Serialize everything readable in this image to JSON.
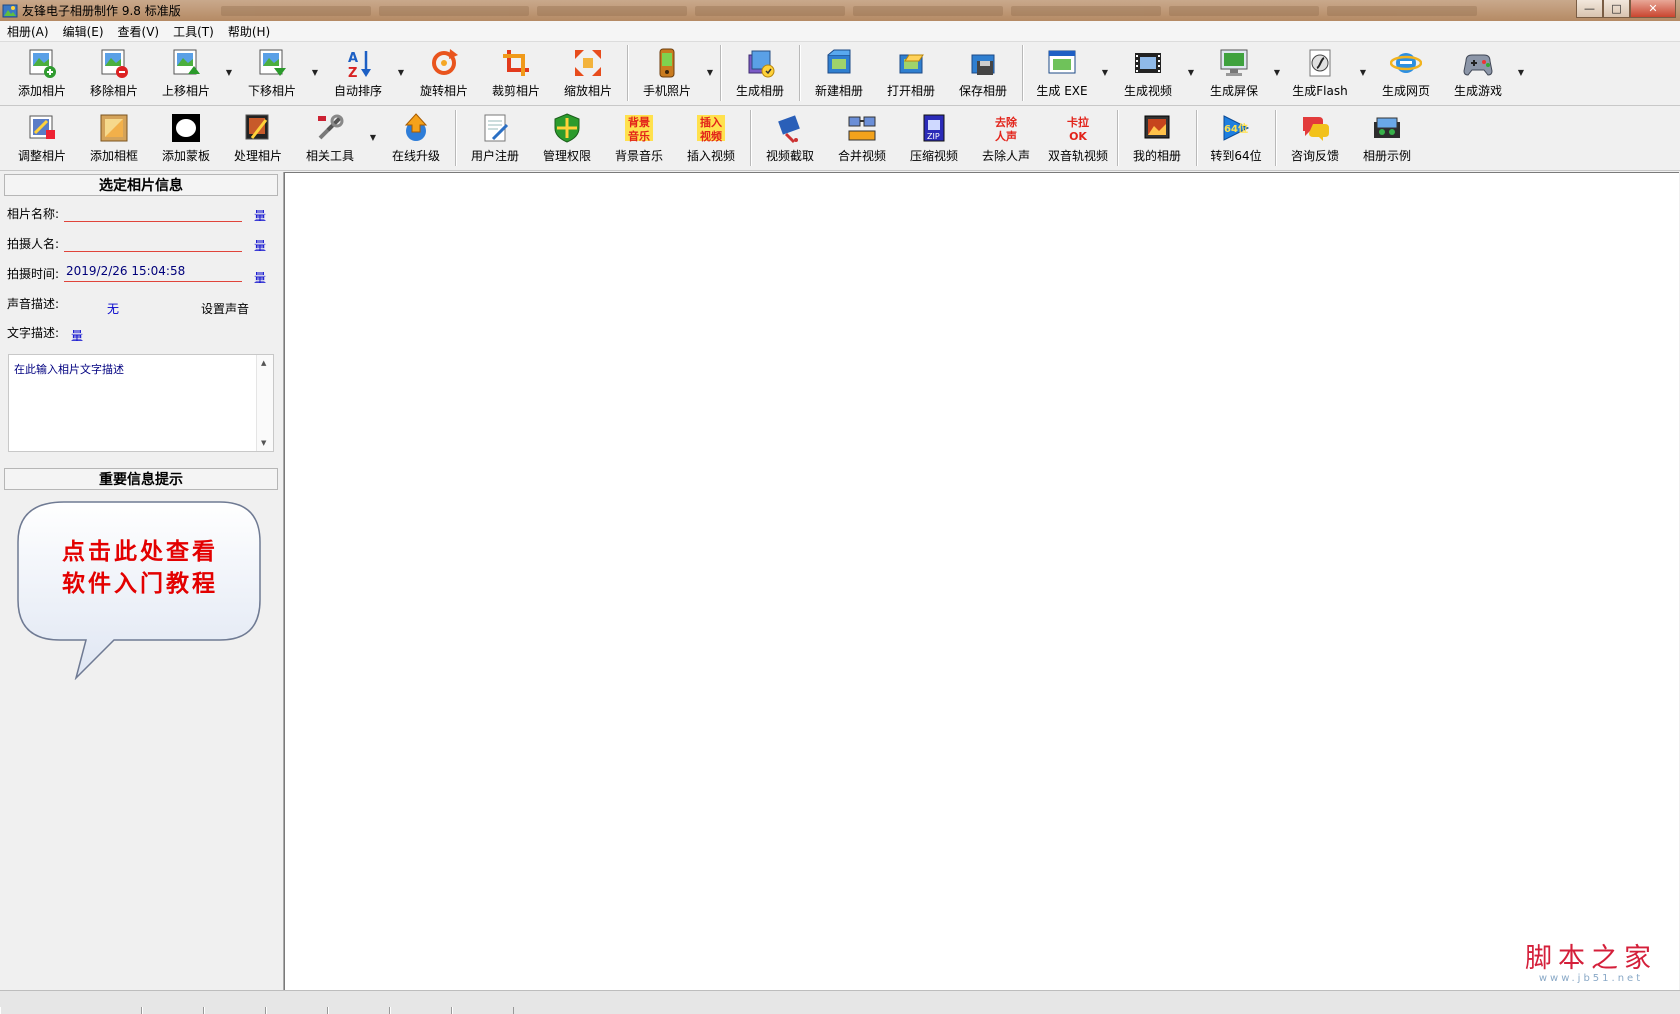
{
  "window": {
    "title": "友锋电子相册制作 9.8 标准版",
    "controls": {
      "minimize": "—",
      "maximize": "□",
      "close": "✕"
    }
  },
  "menu": [
    "相册(A)",
    "编辑(E)",
    "查看(V)",
    "工具(T)",
    "帮助(H)"
  ],
  "toolbar_top": {
    "groups": [
      [
        {
          "label": "添加相片",
          "icon": "add-photo-icon"
        },
        {
          "label": "移除相片",
          "icon": "remove-photo-icon"
        },
        {
          "label": "上移相片",
          "icon": "move-up-icon",
          "dropdown": true
        },
        {
          "label": "下移相片",
          "icon": "move-down-icon",
          "dropdown": true
        },
        {
          "label": "自动排序",
          "icon": "sort-az-icon",
          "dropdown": true
        },
        {
          "label": "旋转相片",
          "icon": "rotate-icon"
        },
        {
          "label": "裁剪相片",
          "icon": "crop-icon"
        },
        {
          "label": "缩放相片",
          "icon": "zoom-icon"
        }
      ],
      [
        {
          "label": "手机照片",
          "icon": "phone-icon",
          "dropdown": true
        }
      ],
      [
        {
          "label": "生成相册",
          "icon": "generate-album-icon"
        }
      ],
      [
        {
          "label": "新建相册",
          "icon": "new-album-icon"
        },
        {
          "label": "打开相册",
          "icon": "open-album-icon"
        },
        {
          "label": "保存相册",
          "icon": "save-album-icon"
        }
      ],
      [
        {
          "label": "生成 EXE",
          "icon": "exe-icon",
          "dropdown": true
        },
        {
          "label": "生成视频",
          "icon": "film-icon",
          "dropdown": true
        },
        {
          "label": "生成屏保",
          "icon": "monitor-icon",
          "dropdown": true
        },
        {
          "label": "生成Flash",
          "icon": "flash-icon",
          "dropdown": true
        },
        {
          "label": "生成网页",
          "icon": "ie-icon"
        },
        {
          "label": "生成游戏",
          "icon": "gamepad-icon",
          "dropdown": true
        }
      ]
    ]
  },
  "toolbar_bottom": {
    "groups": [
      [
        {
          "label": "调整相片",
          "icon": "adjust-photo-icon"
        },
        {
          "label": "添加相框",
          "icon": "frame-icon"
        },
        {
          "label": "添加蒙板",
          "icon": "mask-icon"
        },
        {
          "label": "处理相片",
          "icon": "process-photo-icon"
        },
        {
          "label": "相关工具",
          "icon": "tools-icon",
          "dropdown": true
        },
        {
          "label": "在线升级",
          "icon": "upgrade-icon"
        }
      ],
      [
        {
          "label": "用户注册",
          "icon": "register-icon"
        },
        {
          "label": "管理权限",
          "icon": "shield-icon"
        },
        {
          "label": "背景音乐",
          "icon": "music-icon",
          "badge": [
            "背景",
            "音乐"
          ]
        },
        {
          "label": "插入视频",
          "icon": "insert-video-icon",
          "badge": [
            "插入",
            "视频"
          ]
        }
      ],
      [
        {
          "label": "视频截取",
          "icon": "video-cut-icon"
        },
        {
          "label": "合并视频",
          "icon": "merge-video-icon"
        },
        {
          "label": "压缩视频",
          "icon": "compress-video-icon"
        },
        {
          "label": "去除人声",
          "icon": "remove-voice-icon",
          "badge": [
            "去除",
            "人声"
          ]
        },
        {
          "label": "双音轨视频",
          "icon": "karaoke-icon",
          "badge": [
            "卡拉",
            "OK"
          ]
        }
      ],
      [
        {
          "label": "我的相册",
          "icon": "my-album-icon"
        }
      ],
      [
        {
          "label": "转到64位",
          "icon": "x64-icon",
          "badge": [
            "64位"
          ]
        }
      ],
      [
        {
          "label": "咨询反馈",
          "icon": "feedback-icon"
        },
        {
          "label": "相册示例",
          "icon": "example-icon"
        }
      ]
    ]
  },
  "photo_info": {
    "header": "选定相片信息",
    "name_label": "相片名称:",
    "name_value": "",
    "photographer_label": "拍摄人名:",
    "photographer_value": "",
    "time_label": "拍摄时间:",
    "time_value": "2019/2/26 15:04:58",
    "sound_label": "声音描述:",
    "sound_value": "无",
    "sound_set": "设置声音",
    "text_label": "文字描述:",
    "edit_link": "量",
    "desc_placeholder": "在此输入相片文字描述"
  },
  "tips": {
    "header": "重要信息提示",
    "bubble_line1": "点击此处查看",
    "bubble_line2": "软件入门教程"
  },
  "watermark": {
    "main": "脚本之家",
    "sub": "www.jb51.net"
  },
  "colors": {
    "accent_red": "#e30000",
    "link_blue": "#0000cc",
    "watermark_red": "#d41f3a"
  }
}
